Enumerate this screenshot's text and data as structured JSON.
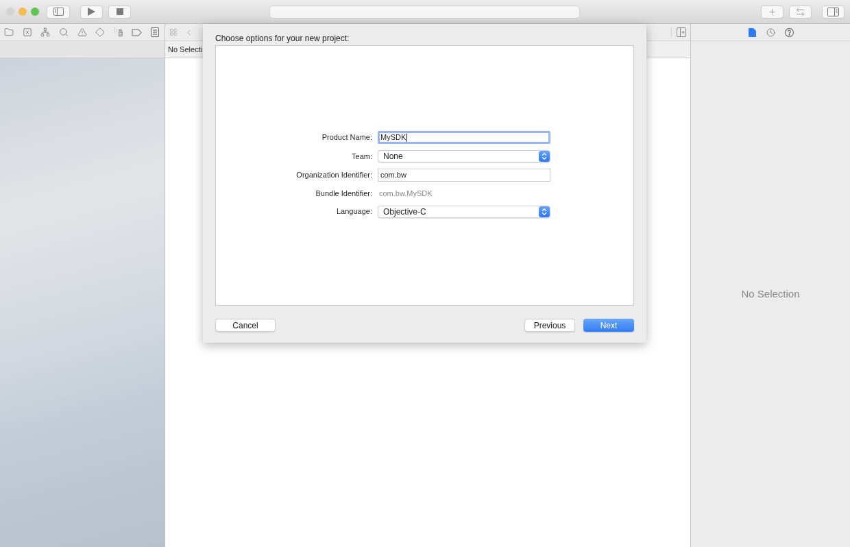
{
  "window_controls": [
    {
      "color": "#d3d3d3"
    },
    {
      "color": "#f5bd4f"
    },
    {
      "color": "#5ec453"
    }
  ],
  "editor": {
    "tab_label": "No Selecti"
  },
  "inspector": {
    "tabs": [
      {
        "kind": "file",
        "selected": true
      },
      {
        "kind": "history",
        "selected": false
      },
      {
        "kind": "help",
        "selected": false
      }
    ],
    "empty_message": "No Selection"
  },
  "dialog": {
    "title": "Choose options for your new project:",
    "fields": [
      {
        "kind": "text",
        "label": "Product Name:",
        "value": "MySDK",
        "focused": true
      },
      {
        "kind": "popup",
        "label": "Team:",
        "value": "None",
        "focused": false
      },
      {
        "kind": "text",
        "label": "Organization Identifier:",
        "value": "com.bw",
        "focused": false
      },
      {
        "kind": "static",
        "label": "Bundle Identifier:",
        "value": "com.bw.MySDK",
        "focused": false
      },
      {
        "kind": "popup",
        "label": "Language:",
        "value": "Objective-C",
        "focused": false
      }
    ],
    "buttons": [
      {
        "label": "Cancel",
        "default": false
      },
      {
        "label": "Previous",
        "default": false
      },
      {
        "label": "Next",
        "default": true
      }
    ]
  }
}
